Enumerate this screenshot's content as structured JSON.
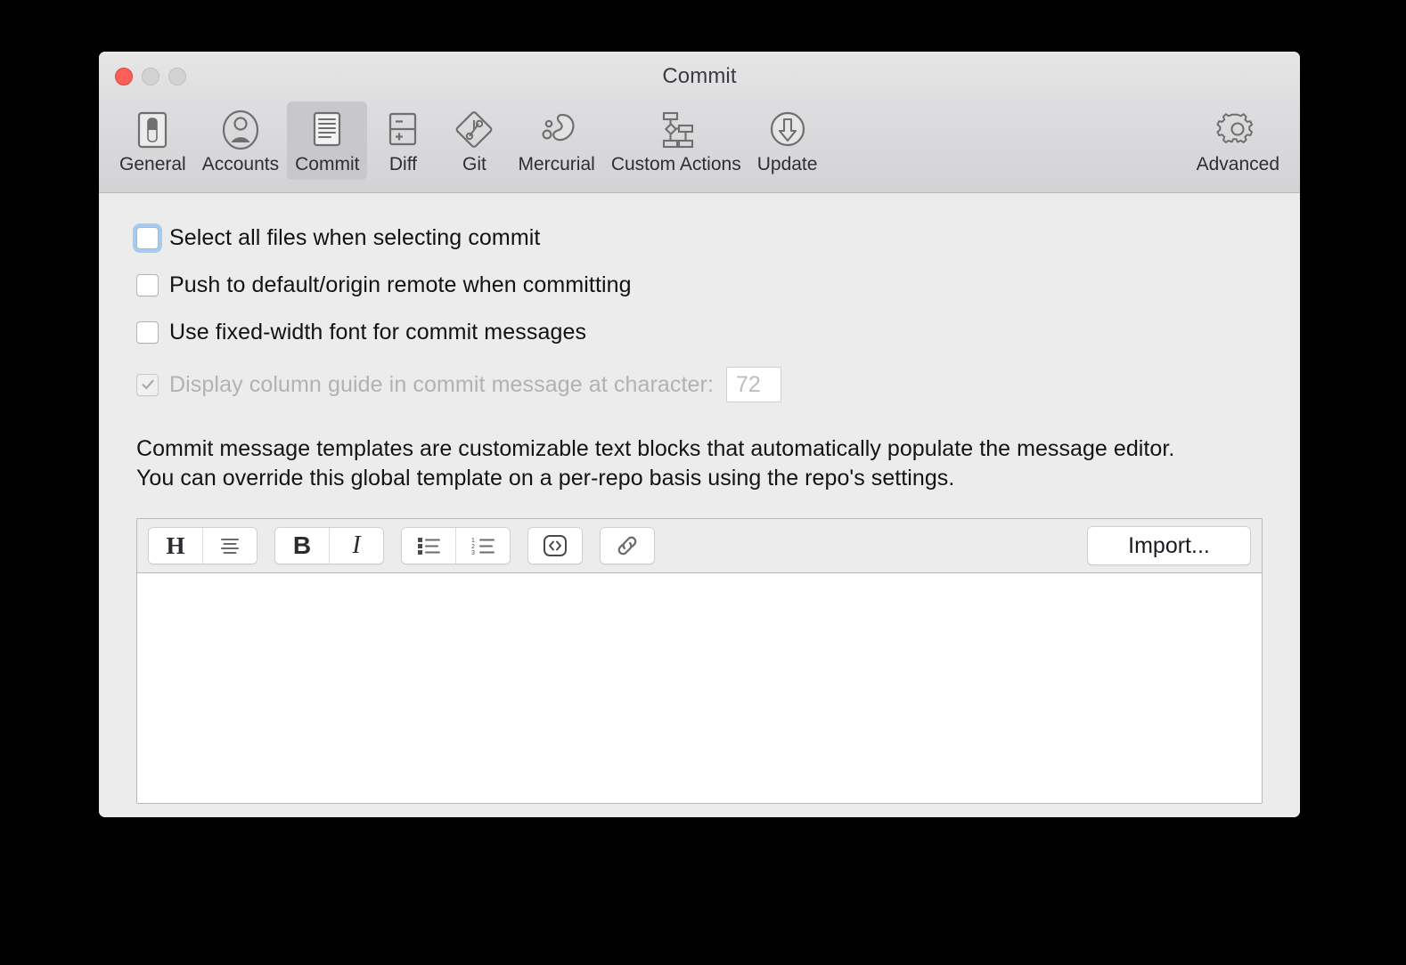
{
  "window": {
    "title": "Commit",
    "traffic_lights": [
      {
        "name": "close-button",
        "color": "#fc5f57"
      },
      {
        "name": "minimize-button",
        "color": "#d2d2d2"
      },
      {
        "name": "zoom-button",
        "color": "#d2d2d2"
      }
    ]
  },
  "toolbar": {
    "items": [
      {
        "label": "General",
        "icon": "toggle-switch-icon",
        "selected": false
      },
      {
        "label": "Accounts",
        "icon": "user-circle-icon",
        "selected": false
      },
      {
        "label": "Commit",
        "icon": "document-lines-icon",
        "selected": true
      },
      {
        "label": "Diff",
        "icon": "plus-minus-split-icon",
        "selected": false
      },
      {
        "label": "Git",
        "icon": "git-diamond-icon",
        "selected": false
      },
      {
        "label": "Mercurial",
        "icon": "mercurial-droplet-icon",
        "selected": false
      },
      {
        "label": "Custom Actions",
        "icon": "node-tree-icon",
        "selected": false
      },
      {
        "label": "Update",
        "icon": "download-arrow-icon",
        "selected": false
      }
    ],
    "trailing": [
      {
        "label": "Advanced",
        "icon": "gear-icon",
        "selected": false
      }
    ]
  },
  "options": [
    {
      "label": "Select all files when selecting commit",
      "checked": false,
      "disabled": false,
      "focused": true
    },
    {
      "label": "Push to default/origin remote when committing",
      "checked": false,
      "disabled": false,
      "focused": false
    },
    {
      "label": "Use fixed-width font for commit messages",
      "checked": false,
      "disabled": false,
      "focused": false
    },
    {
      "label": "Display column guide in commit message at character:",
      "checked": true,
      "disabled": true,
      "focused": false,
      "field_value": "72"
    }
  ],
  "description": {
    "line1": "Commit message templates are customizable text blocks that automatically populate the message editor.",
    "line2": "You can override this global template on a per-repo basis using the repo's settings."
  },
  "editor": {
    "toolbar_groups": [
      {
        "buttons": [
          {
            "name": "heading-icon",
            "glyph": "H"
          },
          {
            "name": "paragraph-lines-icon",
            "glyph": ""
          }
        ]
      },
      {
        "buttons": [
          {
            "name": "bold-icon",
            "glyph": "B"
          },
          {
            "name": "italic-icon",
            "glyph": "I"
          }
        ]
      },
      {
        "buttons": [
          {
            "name": "bulleted-list-icon",
            "glyph": ""
          },
          {
            "name": "numbered-list-icon",
            "glyph": ""
          }
        ]
      },
      {
        "buttons": [
          {
            "name": "code-icon",
            "glyph": "<>"
          }
        ]
      },
      {
        "buttons": [
          {
            "name": "link-icon",
            "glyph": ""
          }
        ]
      }
    ],
    "import_label": "Import...",
    "template_value": "",
    "template_placeholder": ""
  },
  "colors": {
    "accent_focus": "#a5ccf0",
    "close_red": "#fc5f57",
    "window_bg": "#ececec",
    "toolbar_bg": "#d6d5d7",
    "selected_tab_bg": "#c8c7c9"
  }
}
